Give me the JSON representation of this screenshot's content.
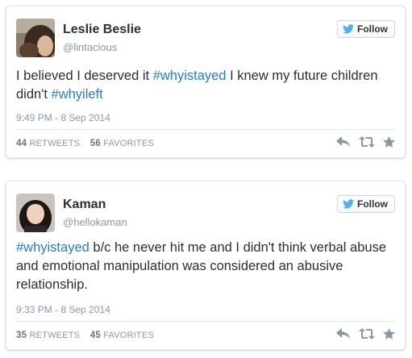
{
  "follow_label": "Follow",
  "colors": {
    "hashtag": "#2b7bb9",
    "name": "#292f33",
    "muted": "#8899a6",
    "twitter_blue": "#55acee"
  },
  "tweets": [
    {
      "name": "Leslie Beslie",
      "handle": "@lintacious",
      "text_parts": [
        "I believed I deserved it ",
        "#whyistayed",
        " I knew my future children didn't ",
        "#whyileft"
      ],
      "timestamp": "9:49 PM - 8 Sep 2014",
      "retweets": "44",
      "retweets_label": "RETWEETS",
      "favorites": "56",
      "favorites_label": "FAVORITES"
    },
    {
      "name": "Kaman",
      "handle": "@hellokaman",
      "text_parts": [
        "#whyistayed",
        " b/c he never hit me and I didn't think verbal abuse and emotional manipulation was considered an abusive relationship."
      ],
      "timestamp": "9:33 PM - 8 Sep 2014",
      "retweets": "35",
      "retweets_label": "RETWEETS",
      "favorites": "45",
      "favorites_label": "FAVORITES"
    }
  ],
  "icons": {
    "follow": "twitter-bird-icon",
    "reply": "reply-icon",
    "retweet": "retweet-icon",
    "favorite": "star-icon"
  }
}
